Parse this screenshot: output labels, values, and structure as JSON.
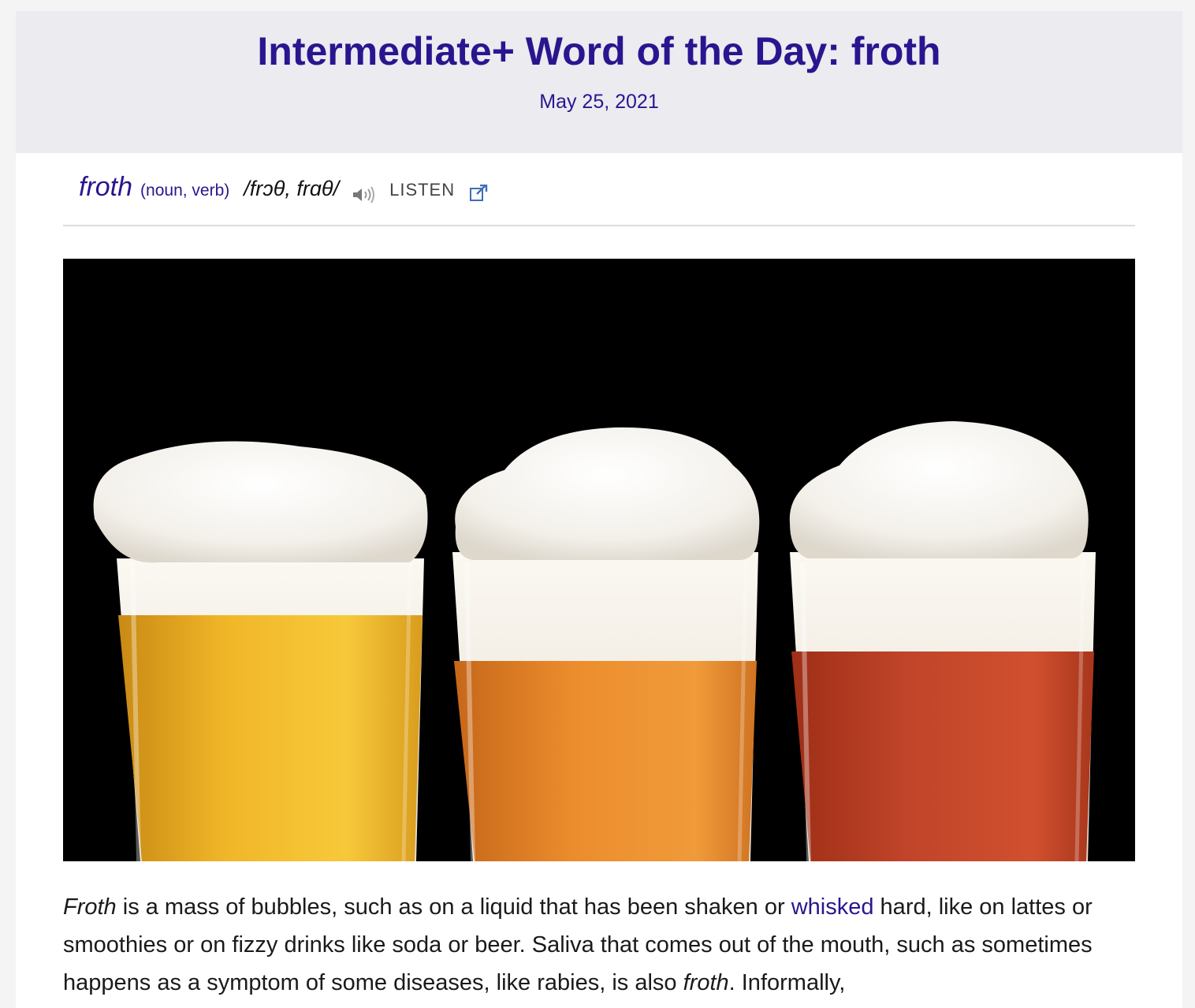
{
  "header": {
    "title": "Intermediate+ Word of the Day: froth",
    "date": "May 25, 2021"
  },
  "entry": {
    "word": "froth",
    "part_of_speech": "(noun, verb)",
    "pronunciation": "/frɔθ, frɑθ/",
    "listen_label": "LISTEN",
    "speaker_icon": "speaker-icon",
    "external_icon": "external-link-icon"
  },
  "image": {
    "subject": "three-beer-glasses-with-froth",
    "background_color": "#000000",
    "liquid_colors": [
      "#f2b423",
      "#e98a2a",
      "#c8432a"
    ],
    "foam_color": "#f5f2ec"
  },
  "definition": {
    "part1": "Froth",
    "part2": " is a mass of bubbles, such as on a liquid that has been shaken or ",
    "link": "whisked",
    "part3": " hard, like on lattes or smoothies or on fizzy drinks like soda or beer. Saliva that comes out of the mouth, such as sometimes happens as a symptom of some diseases, like rabies, is also ",
    "part4": "froth",
    "part5": ". Informally,"
  },
  "colors": {
    "accent": "#29168f",
    "header_bg": "#ebebf0",
    "page_bg": "#f4f4f4"
  }
}
